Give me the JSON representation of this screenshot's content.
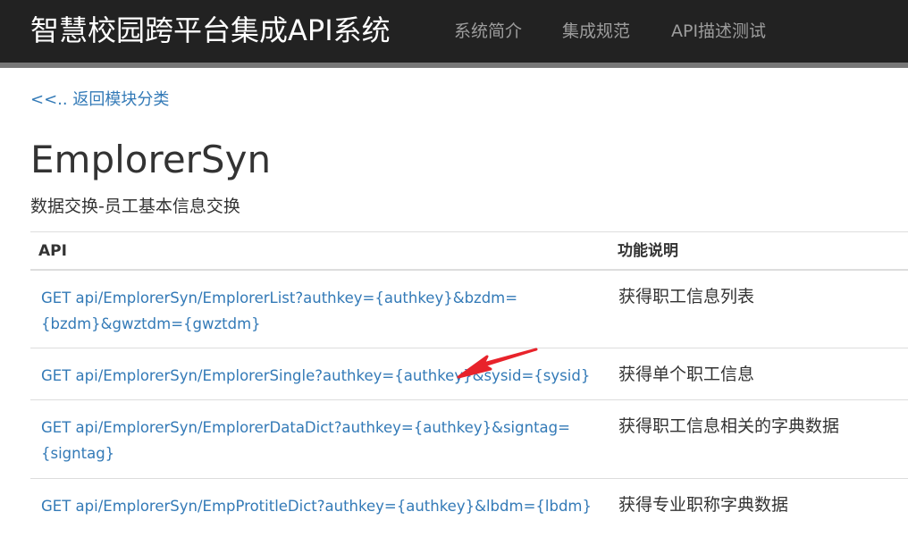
{
  "header": {
    "brand": "智慧校园跨平台集成API系统",
    "nav": [
      {
        "label": "系统简介"
      },
      {
        "label": "集成规范"
      },
      {
        "label": "API描述测试"
      }
    ],
    "colors": {
      "background": "#222222",
      "brand_text": "#ffffff",
      "nav_text": "#9d9d9d"
    }
  },
  "back_link": "<<.. 返回模块分类",
  "page": {
    "title": "EmplorerSyn",
    "description": "数据交换-员工基本信息交换"
  },
  "table": {
    "headers": {
      "api": "API",
      "desc": "功能说明"
    },
    "rows": [
      {
        "api": "GET api/EmplorerSyn/EmplorerList?authkey={authkey}&bzdm={bzdm}&gwztdm={gwztdm}",
        "desc": "获得职工信息列表"
      },
      {
        "api": "GET api/EmplorerSyn/EmplorerSingle?authkey={authkey}&sysid={sysid}",
        "desc": "获得单个职工信息"
      },
      {
        "api": "GET api/EmplorerSyn/EmplorerDataDict?authkey={authkey}&signtag={signtag}",
        "desc": "获得职工信息相关的字典数据"
      },
      {
        "api": "GET api/EmplorerSyn/EmpProtitleDict?authkey={authkey}&lbdm={lbdm}",
        "desc": "获得专业职称字典数据"
      }
    ]
  },
  "annotation": {
    "icon": "red-arrow-icon",
    "color": "#e8232b"
  },
  "link_color": "#337ab7"
}
